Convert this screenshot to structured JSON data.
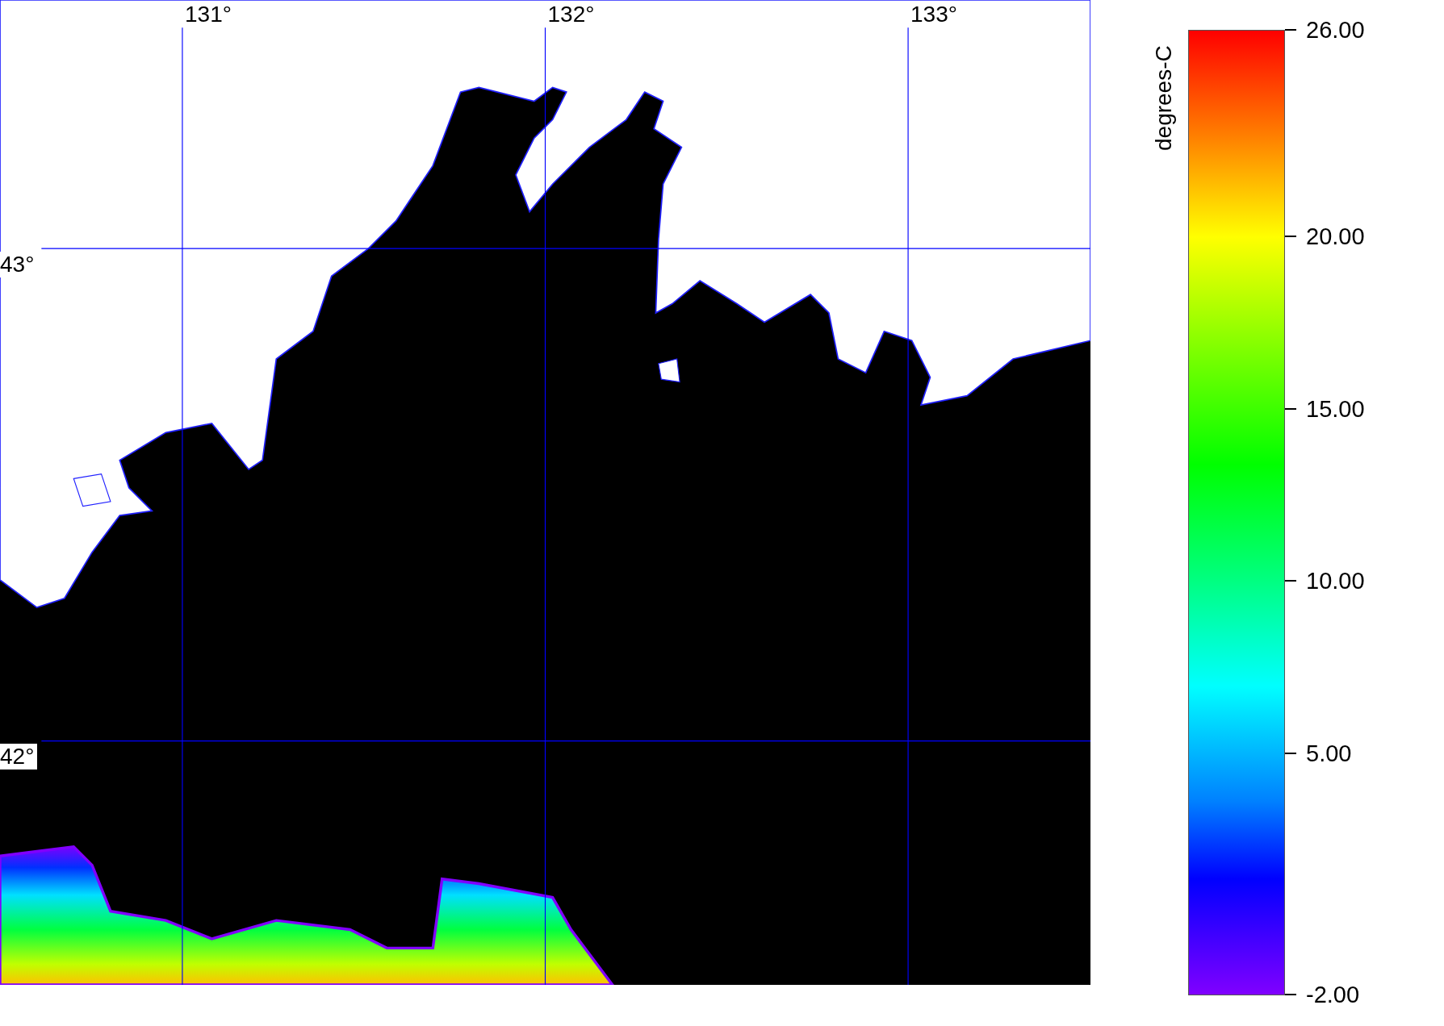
{
  "map": {
    "longitude_labels": [
      "131°",
      "132°",
      "133°"
    ],
    "latitude_labels": [
      "43°",
      "42°"
    ]
  },
  "color_scale": {
    "label": "degrees-C",
    "ticks": [
      "26.00",
      "20.00",
      "15.00",
      "10.00",
      "5.00",
      "-2.00"
    ]
  }
}
